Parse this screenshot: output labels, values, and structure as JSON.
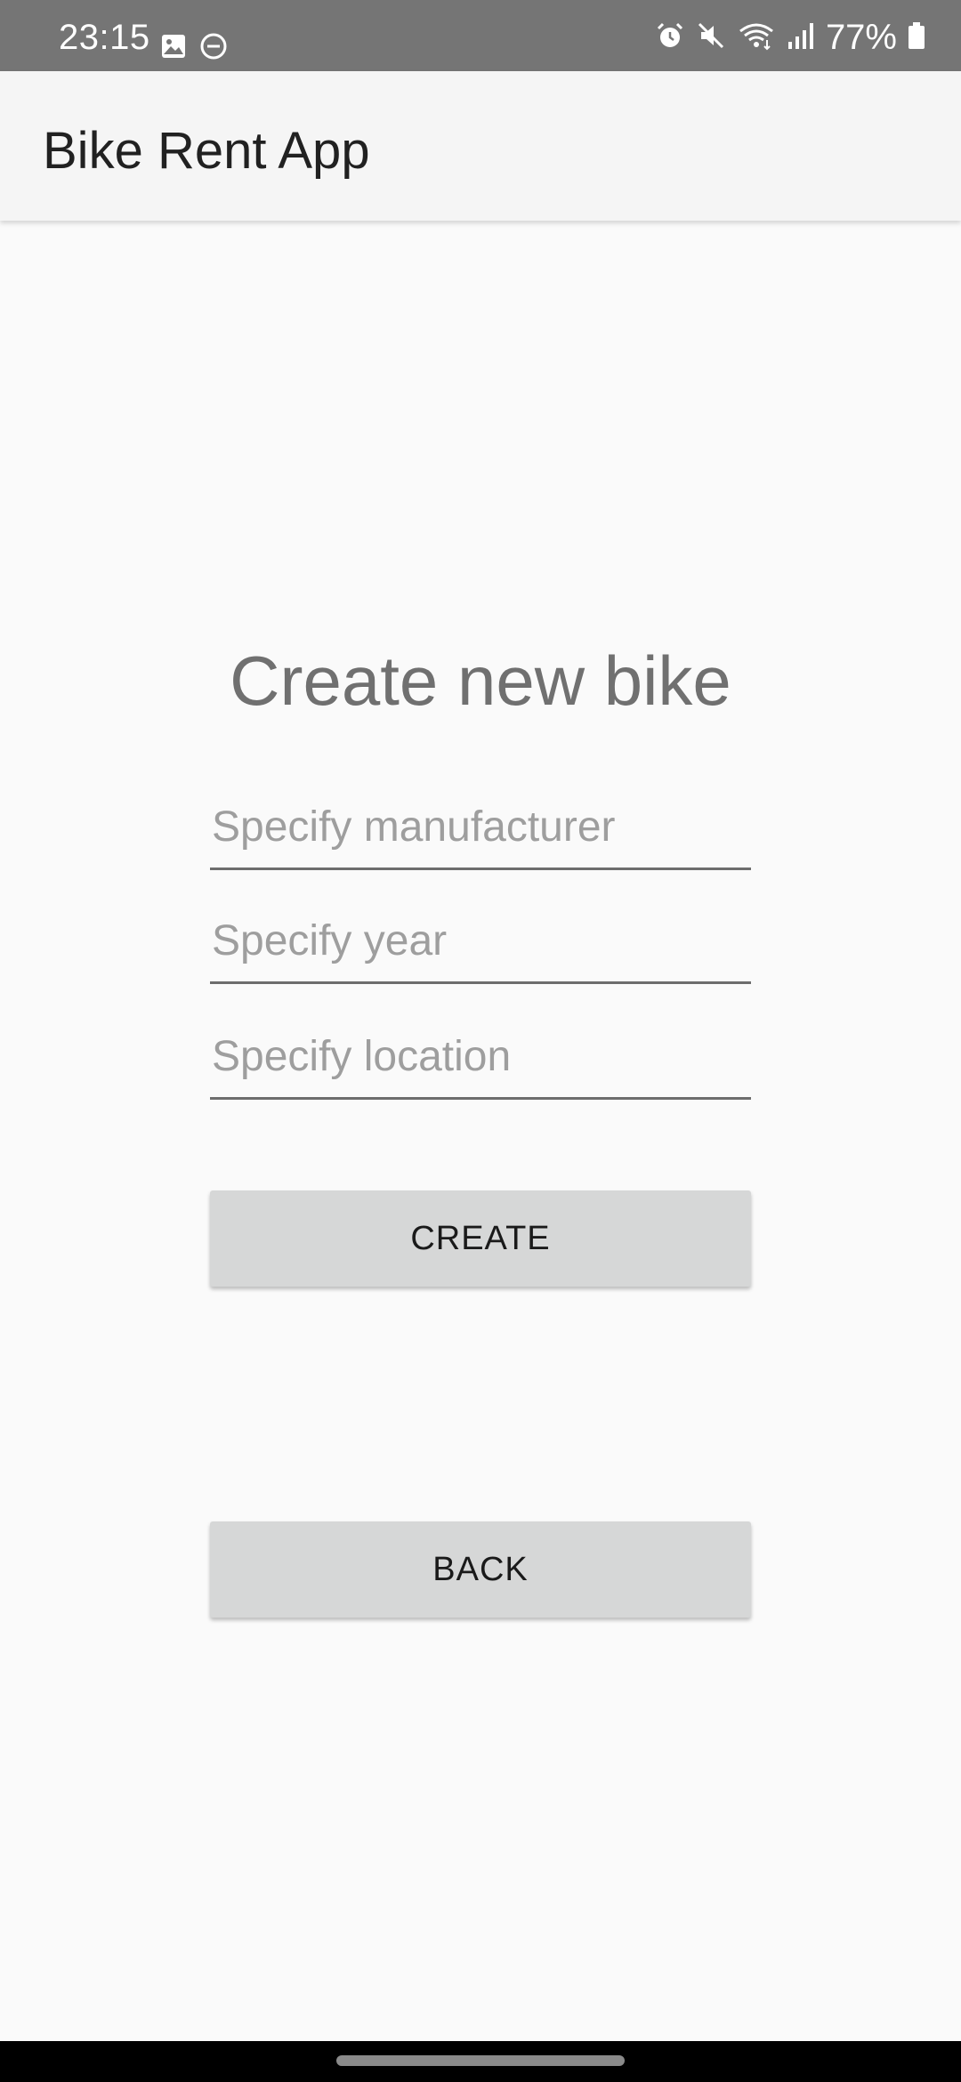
{
  "status_bar": {
    "time": "23:15",
    "left_icons": [
      "image-icon",
      "do-not-disturb-icon"
    ],
    "right_icons": [
      "alarm-icon",
      "mute-icon",
      "wifi-icon",
      "signal-icon",
      "battery-icon"
    ],
    "battery": "77%"
  },
  "app_bar": {
    "title": "Bike Rent App"
  },
  "form": {
    "title": "Create new bike",
    "manufacturer_placeholder": "Specify manufacturer",
    "manufacturer_value": "",
    "year_placeholder": "Specify year",
    "year_value": "",
    "location_placeholder": "Specify location",
    "location_value": "",
    "create_label": "CREATE",
    "back_label": "BACK"
  },
  "colors": {
    "status_bar_bg": "#757575",
    "app_bar_bg": "#f5f5f5",
    "page_bg": "#fafafa",
    "button_bg": "#d6d7d7",
    "title_text": "#707070"
  }
}
